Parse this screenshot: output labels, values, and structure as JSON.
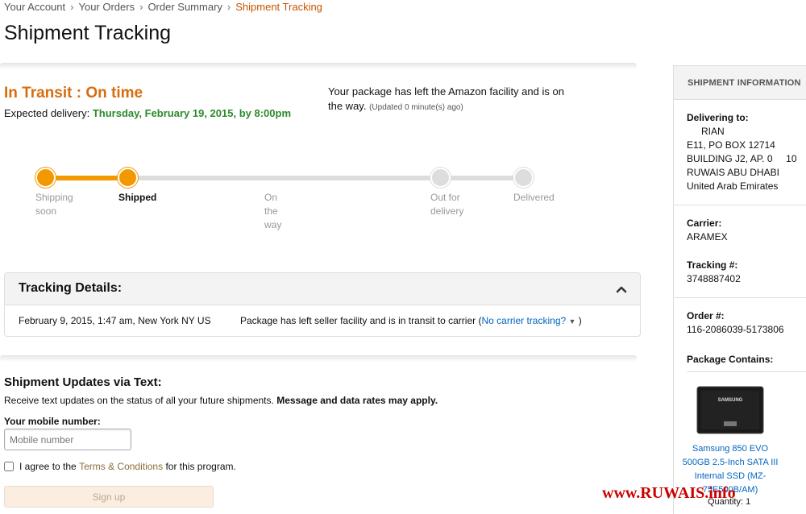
{
  "breadcrumb": [
    "Your Account",
    "Your Orders",
    "Order Summary",
    "Shipment Tracking"
  ],
  "page_title": "Shipment Tracking",
  "status": {
    "title": "In Transit : On time",
    "expected_label": "Expected delivery:",
    "expected_date": "Thursday, February 19, 2015, by 8:00pm",
    "message": "Your package has left the Amazon facility and is on the way.",
    "updated": "(Updated 0 minute(s) ago)"
  },
  "progress": {
    "steps": [
      {
        "label": "Shipping soon",
        "state": "done"
      },
      {
        "label": "Shipped",
        "state": "current"
      },
      {
        "label": "On the way",
        "state": "todo"
      },
      {
        "label": "Out for delivery",
        "state": "todo"
      },
      {
        "label": "Delivered",
        "state": "todo"
      }
    ],
    "completed_fraction": 0.19
  },
  "tracking": {
    "title": "Tracking Details:",
    "rows": [
      {
        "datetime": "February 9, 2015, 1:47 am, New York NY US",
        "description": "Package has left seller facility and is in transit to carrier (",
        "link": "No carrier tracking?",
        "suffix": " )"
      }
    ]
  },
  "sms": {
    "title": "Shipment Updates via Text:",
    "desc": "Receive text updates on the status of all your future shipments.",
    "desc_bold": "Message and data rates may apply.",
    "mobile_label": "Your mobile number:",
    "mobile_placeholder": "Mobile number",
    "agree_prefix": "I agree to the",
    "terms_link": "Terms & Conditions",
    "agree_suffix": "for this program.",
    "signup_label": "Sign up"
  },
  "sidebar": {
    "header": "SHIPMENT INFORMATION",
    "delivering_label": "Delivering to:",
    "address": [
      "RIAN",
      "E11, PO BOX 12714",
      "BUILDING J2, AP. 0     10",
      "RUWAIS ABU DHABI",
      "United Arab Emirates"
    ],
    "carrier_label": "Carrier:",
    "carrier": "ARAMEX",
    "tracking_label": "Tracking #:",
    "tracking_number": "3748887402",
    "order_label": "Order #:",
    "order_number": "116-2086039-5173806",
    "contains_label": "Package Contains:",
    "product_brand": "SAMSUNG",
    "product_name": "Samsung 850 EVO 500GB 2.5-Inch SATA III Internal SSD (MZ-75E500B/AM)",
    "quantity": "Quantity: 1"
  },
  "watermark": "www.RUWAIS.info",
  "colors": {
    "accent": "#f39800",
    "status": "#d66d0e",
    "delivery_date": "#2b8a2b",
    "link": "#0066c0"
  }
}
